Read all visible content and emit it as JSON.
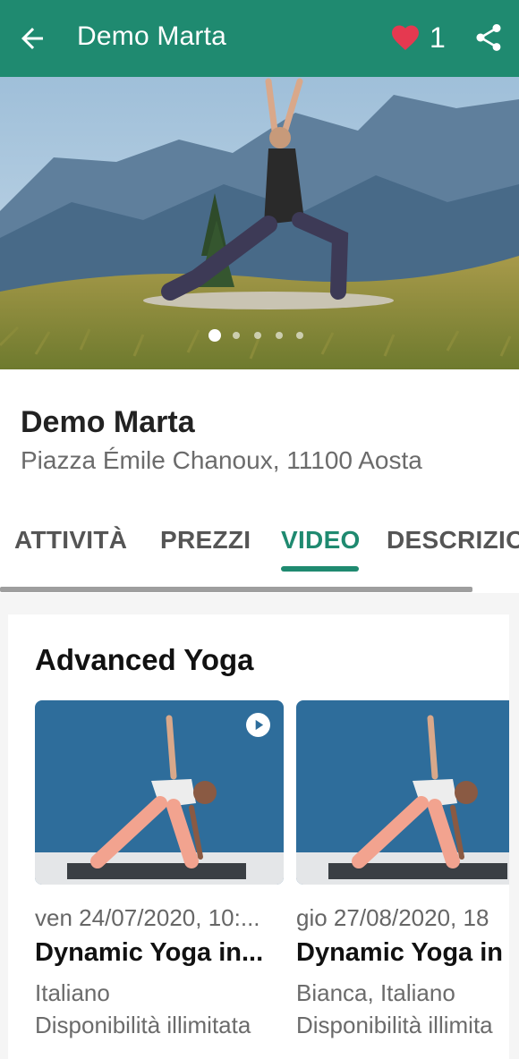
{
  "appbar": {
    "title": "Demo Marta",
    "likes": "1",
    "back_icon": "arrow-left-icon",
    "heart_icon": "heart-icon",
    "share_icon": "share-icon",
    "color": "#1f8a70"
  },
  "hero": {
    "slides_count": 5,
    "active_slide": 1
  },
  "profile": {
    "name": "Demo Marta",
    "address": "Piazza Émile Chanoux, 11100 Aosta"
  },
  "tabs": [
    {
      "label": "ATTIVITÀ",
      "active": false
    },
    {
      "label": "PREZZI",
      "active": false
    },
    {
      "label": "VIDEO",
      "active": true
    },
    {
      "label": "DESCRIZIO",
      "active": false
    }
  ],
  "section": {
    "title": "Advanced Yoga",
    "videos": [
      {
        "date": "ven 24/07/2020, 10:...",
        "title": "Dynamic Yoga in...",
        "language": "Italiano",
        "availability": "Disponibilità illimitata",
        "play_icon": "play-icon"
      },
      {
        "date": "gio 27/08/2020, 18",
        "title": "Dynamic Yoga in",
        "language": "Bianca, Italiano",
        "availability": "Disponibilità illimita"
      }
    ]
  }
}
